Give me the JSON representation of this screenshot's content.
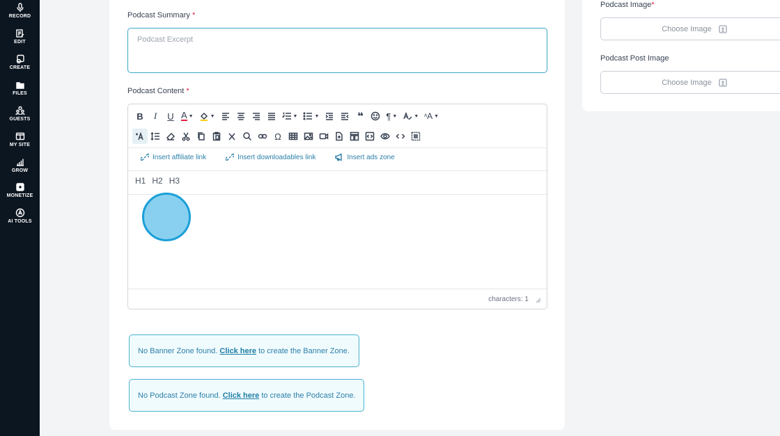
{
  "sidebar": {
    "items": [
      {
        "label": "RECORD",
        "icon": "mic-icon"
      },
      {
        "label": "EDIT",
        "icon": "edit-icon"
      },
      {
        "label": "CREATE",
        "icon": "create-icon"
      },
      {
        "label": "FILES",
        "icon": "folder-icon"
      },
      {
        "label": "GUESTS",
        "icon": "guests-icon"
      },
      {
        "label": "MY SITE",
        "icon": "site-icon"
      },
      {
        "label": "GROW",
        "icon": "chart-icon"
      },
      {
        "label": "MONETIZE",
        "icon": "monetize-icon"
      },
      {
        "label": "AI TOOLS",
        "icon": "ai-icon"
      }
    ]
  },
  "form": {
    "summary_label": "Podcast Summary",
    "summary_placeholder": "Podcast Excerpt",
    "content_label": "Podcast Content",
    "required_mark": "*"
  },
  "editor": {
    "insert_affiliate": "Insert affiliate link",
    "insert_downloadables": "Insert downloadables link",
    "insert_ads": "Insert ads zone",
    "h1": "H1",
    "h2": "H2",
    "h3": "H3",
    "char_count": "characters: 1"
  },
  "notices": {
    "banner_prefix": "No Banner Zone found.",
    "banner_link": "Click here",
    "banner_suffix": "to create the Banner Zone.",
    "podcast_prefix": "No Podcast Zone found.",
    "podcast_link": "Click here",
    "podcast_suffix": "to create the Podcast Zone."
  },
  "right_panel": {
    "podcast_image_label": "Podcast Image",
    "podcast_post_image_label": "Podcast Post Image",
    "choose_image": "Choose Image"
  },
  "colors": {
    "sidebar_bg": "#0c1621",
    "accent": "#2c7fa8",
    "required": "#e11d48",
    "notice_border": "#4bb3cf"
  }
}
